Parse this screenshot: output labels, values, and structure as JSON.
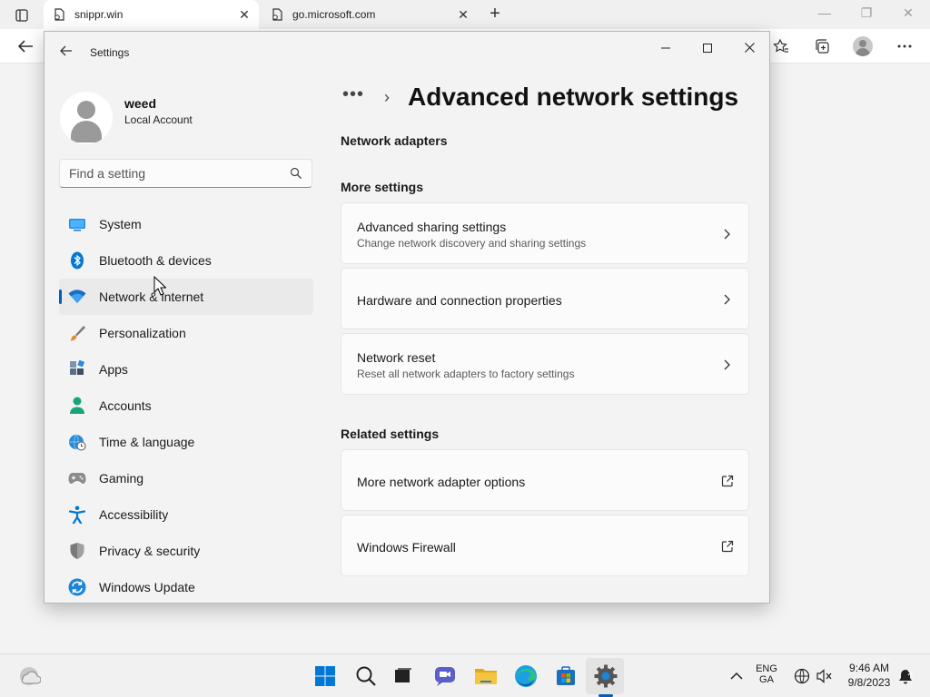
{
  "browser": {
    "tabs": [
      {
        "title": "snippr.win",
        "active": true
      },
      {
        "title": "go.microsoft.com",
        "active": false
      }
    ],
    "new_tab_glyph": "+",
    "close_glyph": "✕"
  },
  "settings": {
    "window_title": "Settings",
    "user": {
      "name": "weed",
      "account_type": "Local Account"
    },
    "search_placeholder": "Find a setting",
    "nav": [
      {
        "label": "System",
        "icon": "system-icon"
      },
      {
        "label": "Bluetooth & devices",
        "icon": "bluetooth-icon"
      },
      {
        "label": "Network & internet",
        "icon": "wifi-icon",
        "active": true
      },
      {
        "label": "Personalization",
        "icon": "brush-icon"
      },
      {
        "label": "Apps",
        "icon": "apps-icon"
      },
      {
        "label": "Accounts",
        "icon": "person-icon"
      },
      {
        "label": "Time & language",
        "icon": "globe-clock-icon"
      },
      {
        "label": "Gaming",
        "icon": "gamepad-icon"
      },
      {
        "label": "Accessibility",
        "icon": "accessibility-icon"
      },
      {
        "label": "Privacy & security",
        "icon": "shield-icon"
      },
      {
        "label": "Windows Update",
        "icon": "update-icon"
      }
    ],
    "breadcrumb_overflow": "•••",
    "breadcrumb_sep": "›",
    "page_title": "Advanced network settings",
    "sections": {
      "network_adapters": "Network adapters",
      "more_settings": "More settings",
      "related_settings": "Related settings"
    },
    "more_settings_cards": [
      {
        "title": "Advanced sharing settings",
        "subtitle": "Change network discovery and sharing settings"
      },
      {
        "title": "Hardware and connection properties",
        "subtitle": ""
      },
      {
        "title": "Network reset",
        "subtitle": "Reset all network adapters to factory settings"
      }
    ],
    "related_cards": [
      {
        "title": "More network adapter options"
      },
      {
        "title": "Windows Firewall"
      }
    ]
  },
  "taskbar": {
    "language": {
      "line1": "ENG",
      "line2": "GA"
    },
    "clock": {
      "time": "9:46 AM",
      "date": "9/8/2023"
    }
  },
  "colors": {
    "accent": "#005fb8",
    "windows_blue": "#0078d4"
  }
}
